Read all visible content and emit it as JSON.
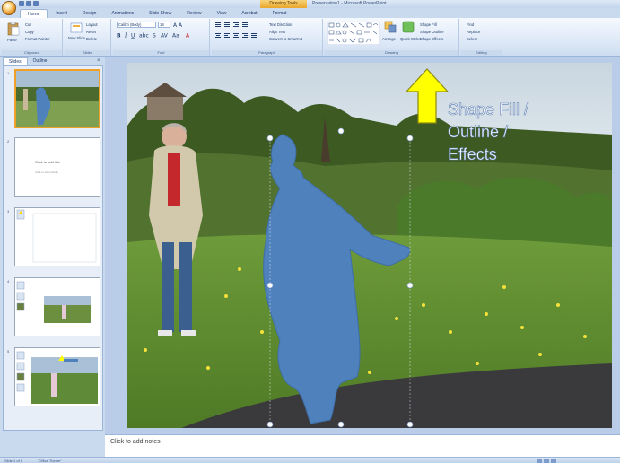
{
  "title_bar": {
    "context_tab": "Drawing Tools",
    "document_title": "Presentation1 - Microsoft PowerPoint"
  },
  "tabs": [
    "Home",
    "Insert",
    "Design",
    "Animations",
    "Slide Show",
    "Review",
    "View",
    "Acrobat",
    "Format"
  ],
  "ribbon": {
    "clipboard": {
      "label": "Clipboard",
      "paste": "Paste",
      "cut": "Cut",
      "copy": "Copy",
      "format_painter": "Format Painter"
    },
    "slides": {
      "label": "Slides",
      "new_slide": "New Slide",
      "layout": "Layout",
      "reset": "Reset",
      "delete": "Delete"
    },
    "font": {
      "label": "Font",
      "font_name": "Calibri (Body)",
      "font_size": "18"
    },
    "paragraph": {
      "label": "Paragraph",
      "text_direction": "Text Direction",
      "align_text": "Align Text",
      "convert_smartart": "Convert to SmartArt"
    },
    "drawing": {
      "label": "Drawing",
      "arrange": "Arrange",
      "quick_styles": "Quick Styles",
      "shape_fill": "Shape Fill",
      "shape_outline": "Shape Outline",
      "shape_effects": "Shape Effects"
    },
    "editing": {
      "label": "Editing",
      "find": "Find",
      "replace": "Replace",
      "select": "Select"
    }
  },
  "panel": {
    "tab_slides": "Slides",
    "tab_outline": "Outline",
    "close": "×"
  },
  "thumbnails": [
    {
      "num": "1",
      "kind": "photo"
    },
    {
      "num": "2",
      "kind": "title",
      "title": "Click to add title",
      "subtitle": "Click to add subtitle"
    },
    {
      "num": "3",
      "kind": "blank"
    },
    {
      "num": "4",
      "kind": "photo-small"
    },
    {
      "num": "5",
      "kind": "photo-title"
    }
  ],
  "slide": {
    "title_lines": [
      "Shape Fill /",
      "Outline /",
      "Effects"
    ]
  },
  "notes": {
    "placeholder": "Click to add notes"
  },
  "status": {
    "slide": "Slide 1 of 5",
    "theme": "\"Office Theme\""
  },
  "colors": {
    "accent": "#4f81bd",
    "arrow": "#ffff00",
    "selected_thumb": "#f0a12a",
    "ribbon": "#dbe7f6"
  }
}
